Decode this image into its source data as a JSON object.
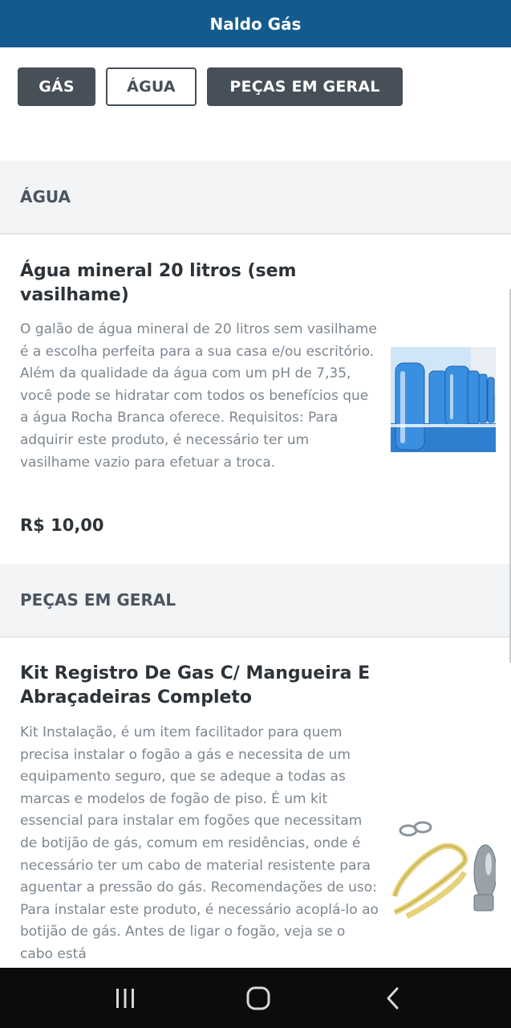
{
  "header": {
    "title": "Naldo Gás"
  },
  "tabs": [
    {
      "label": "GÁS",
      "selected": false
    },
    {
      "label": "ÁGUA",
      "selected": true
    },
    {
      "label": "PEÇAS EM GERAL",
      "selected": false
    }
  ],
  "sections": [
    {
      "title": "ÁGUA",
      "products": [
        {
          "name": "Água mineral 20 litros (sem vasilhame)",
          "description": "O galão de água mineral de 20 litros sem vasilhame é a escolha perfeita para a sua casa e/ou escritório. Além da qualidade da água com um pH de 7,35, você pode se hidratar com todos os benefícios que a água Rocha Branca oferece. Requisitos: Para adquirir este produto, é necessário ter um vasilhame vazio para efetuar a troca.",
          "price": "R$ 10,00",
          "image": "water-gallons-photo"
        }
      ]
    },
    {
      "title": "PEÇAS EM GERAL",
      "products": [
        {
          "name": "Kit Registro De Gas C/ Mangueira E Abraçadeiras Completo",
          "description": "Kit Instalação, é um item facilitador para quem precisa instalar o fogão a gás e necessita de um equipamento seguro, que se adeque a todas as marcas e modelos de fogão de piso. É um kit essencial para instalar em fogões que necessitam de botijão de gás, comum em residências, onde é necessário ter um cabo de material resistente para aguentar a pressão do gás. Recomendações de uso: Para instalar este produto, é necessário acoplá-lo ao botijão de gás. Antes de ligar o fogão, veja se o cabo está",
          "image": "gas-regulator-hose-photo"
        }
      ]
    }
  ],
  "system_nav": {
    "recents_icon": "recents-icon",
    "home_icon": "home-icon",
    "back_icon": "back-icon"
  },
  "colors": {
    "header_bg": "#135b8e",
    "tab_dark": "#474f58",
    "section_bg": "#f3f4f5",
    "desc_text": "#7c868f"
  }
}
